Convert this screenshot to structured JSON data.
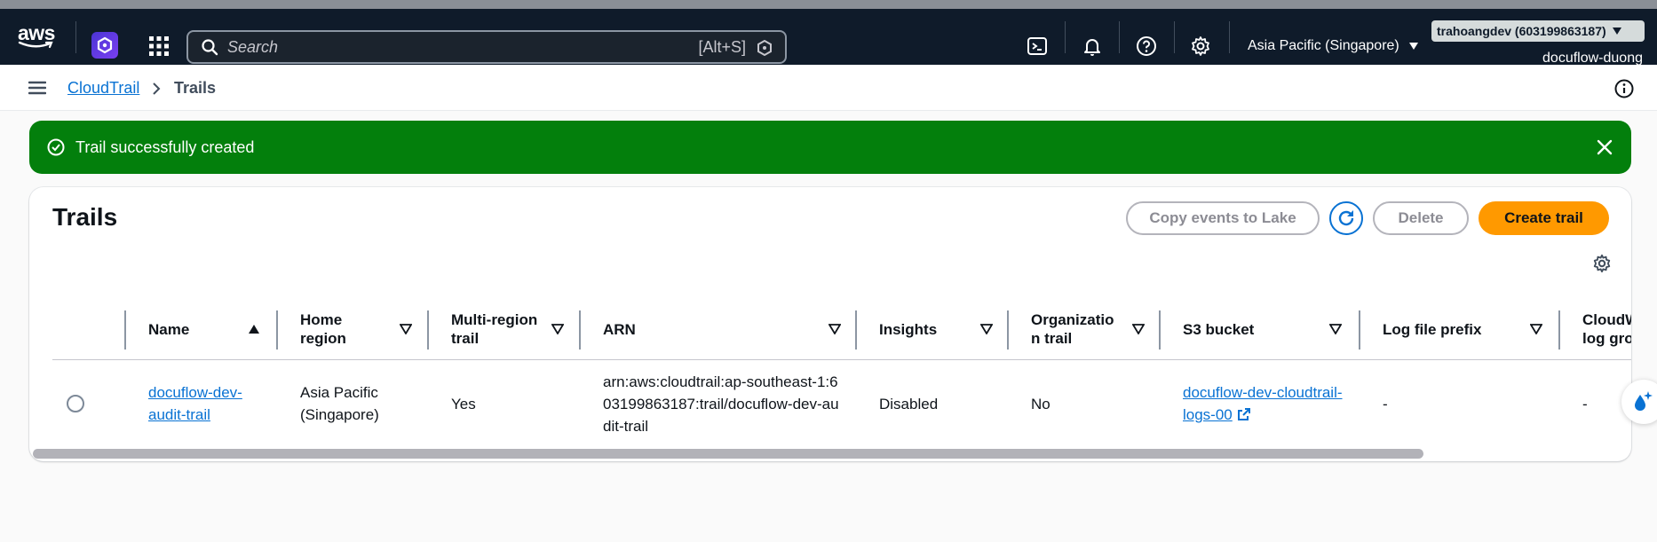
{
  "topbar": {
    "logo_text": "aws",
    "search_placeholder": "Search",
    "search_shortcut": "[Alt+S]",
    "region_label": "Asia Pacific (Singapore)",
    "account_label": "trahoangdev (603199863187)",
    "role_label": "docuflow-duong"
  },
  "breadcrumb": {
    "service": "CloudTrail",
    "current": "Trails"
  },
  "flash": {
    "message": "Trail successfully created"
  },
  "trails": {
    "title": "Trails",
    "buttons": {
      "copy": "Copy events to Lake",
      "delete": "Delete",
      "create": "Create trail"
    },
    "columns": {
      "name": "Name",
      "home_region": "Home region",
      "multi_region": "Multi-region trail",
      "arn": "ARN",
      "insights": "Insights",
      "org_trail": "Organization trail",
      "s3_bucket": "S3 bucket",
      "log_prefix": "Log file prefix",
      "cloudwatch": "CloudWatch log group"
    },
    "rows": [
      {
        "name": "docuflow-dev-audit-trail",
        "home_region": "Asia Pacific (Singapore)",
        "multi_region": "Yes",
        "arn": "arn:aws:cloudtrail:ap-southeast-1:603199863187:trail/docuflow-dev-audit-trail",
        "insights": "Disabled",
        "org_trail": "No",
        "s3_bucket": "docuflow-dev-cloudtrail-logs-00",
        "log_prefix": "-",
        "cloudwatch": "-"
      }
    ]
  },
  "colors": {
    "topbar_bg": "#0f1b2a",
    "flash_success": "#037f0c",
    "primary_button": "#ff9900",
    "link": "#0972d3"
  }
}
